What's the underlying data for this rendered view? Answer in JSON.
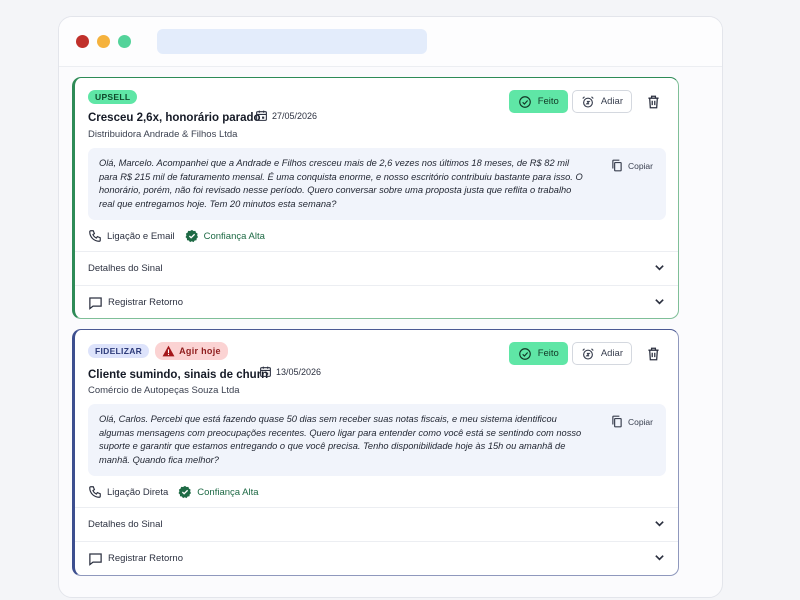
{
  "cards": [
    {
      "badge": "UPSELL",
      "title": "Cresceu 2,6x, honorário parado",
      "date": "27/05/2026",
      "company": "Distribuidora Andrade & Filhos Ltda",
      "message": "Olá, Marcelo. Acompanhei que a Andrade e Filhos cresceu mais de 2,6 vezes nos últimos 18 meses, de R$ 82 mil para R$ 215 mil de faturamento mensal. É uma conquista enorme, e nosso escritório contribuiu bastante para isso. O honorário, porém, não foi revisado nesse período. Quero conversar sobre uma proposta justa que reflita o trabalho real que entregamos hoje. Tem 20 minutos esta semana?",
      "copy_label": "Copiar",
      "channel": "Ligação e Email",
      "confidence": "Confiança Alta",
      "done_label": "Feito",
      "snooze_label": "Adiar",
      "details_label": "Detalhes do Sinal",
      "register_label": "Registrar Retorno"
    },
    {
      "badge": "FIDELIZAR",
      "urgent_label": "Agir hoje",
      "title": "Cliente sumindo, sinais de churn",
      "date": "13/05/2026",
      "company": "Comércio de Autopeças Souza Ltda",
      "message": "Olá, Carlos. Percebi que está fazendo quase 50 dias sem receber suas notas fiscais, e meu sistema identificou algumas mensagens com preocupações recentes. Quero ligar para entender como você está se sentindo com nosso suporte e garantir que estamos entregando o que você precisa. Tenho disponibilidade hoje às 15h ou amanhã de manhã. Quando fica melhor?",
      "copy_label": "Copiar",
      "channel": "Ligação Direta",
      "confidence": "Confiança Alta",
      "done_label": "Feito",
      "snooze_label": "Adiar",
      "details_label": "Detalhes do Sinal",
      "register_label": "Registrar Retorno"
    }
  ],
  "icons": {
    "done": "check-circle-icon",
    "snooze": "alarm-clock-icon",
    "delete": "trash-icon",
    "calendar": "calendar-icon",
    "copy": "copy-icon",
    "phone": "phone-icon",
    "confidence": "verified-badge-icon",
    "expand": "chevron-down-icon",
    "register": "chat-bubble-icon",
    "urgent": "warning-triangle-icon"
  },
  "colors": {
    "upsell_badge": "#5fe6a6",
    "fidelizar_badge": "#dde3fb",
    "urgent_badge": "#fbd3d3",
    "done_button": "#5fe6a6",
    "confidence_text": "#1e6a45"
  }
}
